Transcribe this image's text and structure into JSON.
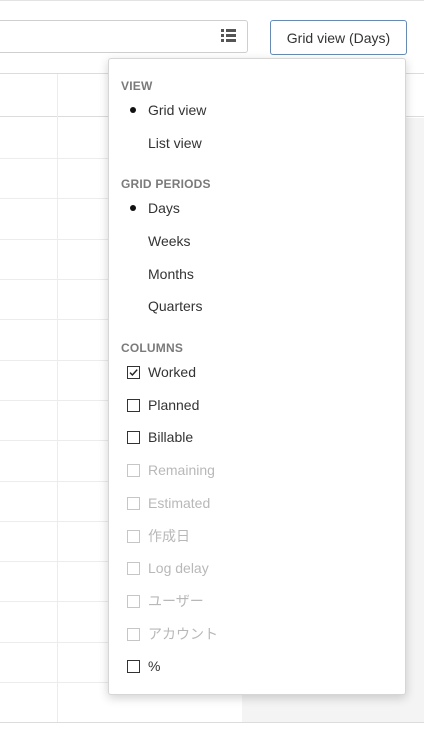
{
  "toolbar": {
    "search_placeholder": "",
    "view_button_label": "Grid view (Days)"
  },
  "dropdown": {
    "view": {
      "title": "VIEW",
      "options": [
        {
          "label": "Grid view",
          "selected": true
        },
        {
          "label": "List view",
          "selected": false
        }
      ]
    },
    "grid_periods": {
      "title": "GRID PERIODS",
      "options": [
        {
          "label": "Days",
          "selected": true
        },
        {
          "label": "Weeks",
          "selected": false
        },
        {
          "label": "Months",
          "selected": false
        },
        {
          "label": "Quarters",
          "selected": false
        }
      ]
    },
    "columns": {
      "title": "COLUMNS",
      "options": [
        {
          "label": "Worked",
          "checked": true,
          "enabled": true
        },
        {
          "label": "Planned",
          "checked": false,
          "enabled": true
        },
        {
          "label": "Billable",
          "checked": false,
          "enabled": true
        },
        {
          "label": "Remaining",
          "checked": false,
          "enabled": false
        },
        {
          "label": "Estimated",
          "checked": false,
          "enabled": false
        },
        {
          "label": "作成日",
          "checked": false,
          "enabled": false
        },
        {
          "label": "Log delay",
          "checked": false,
          "enabled": false
        },
        {
          "label": "ユーザー",
          "checked": false,
          "enabled": false
        },
        {
          "label": "アカウント",
          "checked": false,
          "enabled": false
        },
        {
          "label": "%",
          "checked": false,
          "enabled": true
        }
      ]
    }
  },
  "colors": {
    "accent": "#4a90e2",
    "disabled_text": "#b8b8b8",
    "section_title": "#7a7a7a"
  },
  "icons": {
    "list_view": "list-icon",
    "bullet": "radio-bullet-icon",
    "checkbox": "checkbox-icon"
  }
}
